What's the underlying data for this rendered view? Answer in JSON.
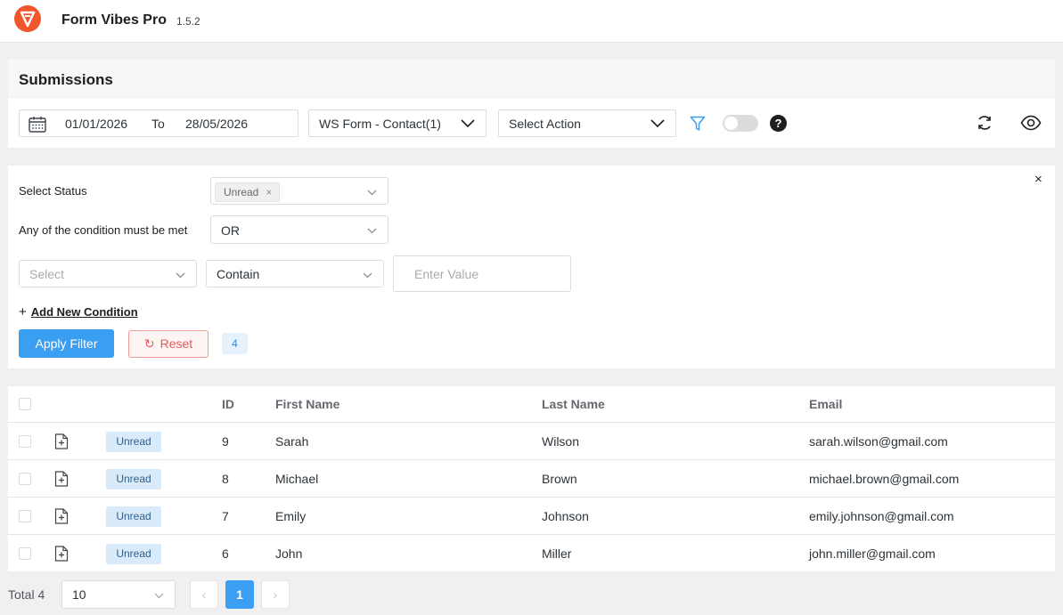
{
  "app": {
    "title": "Form Vibes Pro",
    "version": "1.5.2"
  },
  "submissions": {
    "title": "Submissions",
    "date_from": "01/01/2026",
    "date_to_label": "To",
    "date_to": "28/05/2026",
    "form_select": "WS Form - Contact(1)",
    "action_select": "Select Action",
    "help": "?"
  },
  "filter": {
    "close": "×",
    "status_label": "Select Status",
    "status_tag": "Unread",
    "status_tag_remove": "×",
    "condition_label": "Any of the condition must be met",
    "condition_value": "OR",
    "field_placeholder": "Select",
    "operator_value": "Contain",
    "value_placeholder": "Enter Value",
    "add_plus": "+",
    "add_condition": "Add New Condition",
    "apply": "Apply Filter",
    "reset": "Reset",
    "reset_icon": "↻",
    "count": "4"
  },
  "table": {
    "headers": {
      "id": "ID",
      "first_name": "First Name",
      "last_name": "Last Name",
      "email": "Email"
    },
    "rows": [
      {
        "status": "Unread",
        "id": "9",
        "first_name": "Sarah",
        "last_name": "Wilson",
        "email": "sarah.wilson@gmail.com"
      },
      {
        "status": "Unread",
        "id": "8",
        "first_name": "Michael",
        "last_name": "Brown",
        "email": "michael.brown@gmail.com"
      },
      {
        "status": "Unread",
        "id": "7",
        "first_name": "Emily",
        "last_name": "Johnson",
        "email": "emily.johnson@gmail.com"
      },
      {
        "status": "Unread",
        "id": "6",
        "first_name": "John",
        "last_name": "Miller",
        "email": "john.miller@gmail.com"
      }
    ]
  },
  "footer": {
    "total": "Total 4",
    "page_size": "10",
    "prev": "‹",
    "current_page": "1",
    "next": "›"
  },
  "colors": {
    "accent": "#3a9ff2",
    "brand": "#f0572a",
    "danger": "#e35b5b",
    "badge": "#d9ebfb"
  }
}
